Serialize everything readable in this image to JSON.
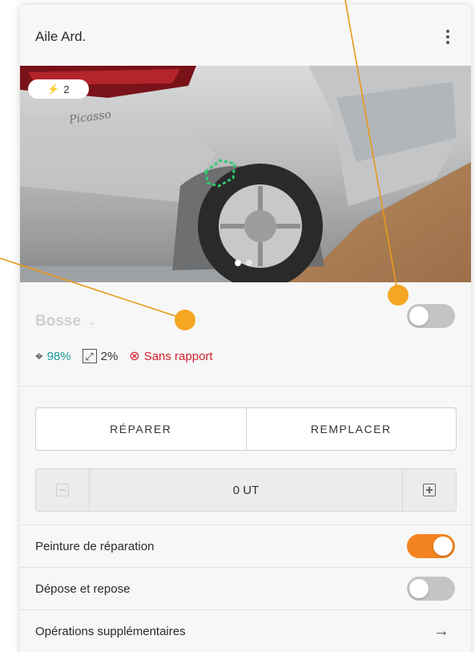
{
  "header": {
    "title": "Aile Ard."
  },
  "photo": {
    "badge_icon": "⚡",
    "badge_count": "2",
    "slide_count": 2,
    "active_slide": 1
  },
  "damage": {
    "type_label": "Bosse",
    "enabled": false
  },
  "metrics": {
    "confidence": "98%",
    "size": "2%",
    "report_status": "Sans rapport"
  },
  "actions": {
    "repair_label": "RÉPARER",
    "replace_label": "REMPLACER"
  },
  "labor": {
    "value": "0 UT"
  },
  "options": [
    {
      "label": "Peinture de réparation",
      "enabled": true
    },
    {
      "label": "Dépose et repose",
      "enabled": false
    }
  ],
  "extra_operations": {
    "label": "Opérations supplémentaires"
  },
  "colors": {
    "accent": "#f2841f",
    "confidence": "#1a9a9a",
    "report_status": "#d0202f",
    "marker": "#f5a623"
  }
}
